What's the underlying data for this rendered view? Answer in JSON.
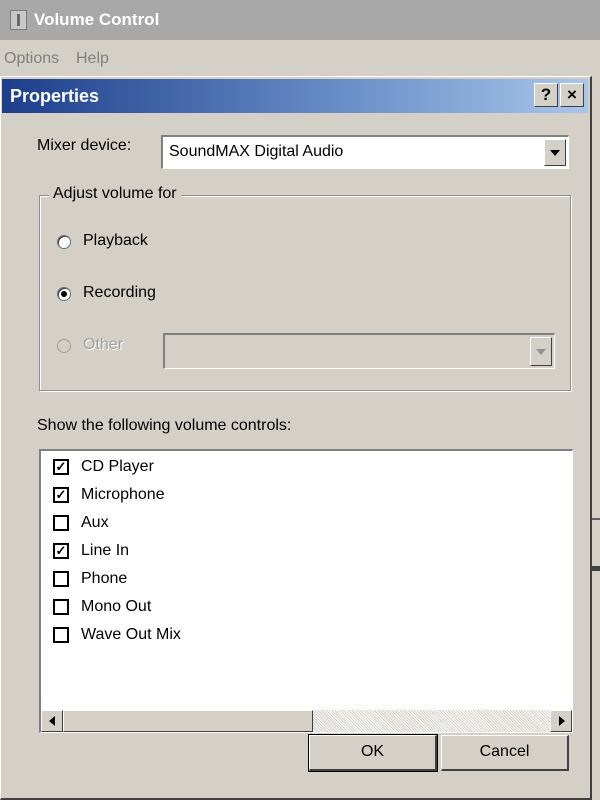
{
  "app": {
    "title": "Volume Control",
    "menu": [
      "Options",
      "Help"
    ]
  },
  "dialog": {
    "title": "Properties",
    "help_button": "?",
    "close_button": "×",
    "mixer_label": "Mixer device:",
    "mixer_value": "SoundMAX Digital Audio",
    "adjust_group": "Adjust volume for",
    "radios": [
      {
        "label": "Playback",
        "checked": false,
        "enabled": true
      },
      {
        "label": "Recording",
        "checked": true,
        "enabled": true
      },
      {
        "label": "Other",
        "checked": false,
        "enabled": false
      }
    ],
    "other_value": "",
    "show_label": "Show the following volume controls:",
    "controls": [
      {
        "label": "CD Player",
        "checked": true
      },
      {
        "label": "Microphone",
        "checked": true
      },
      {
        "label": "Aux",
        "checked": false
      },
      {
        "label": "Line In",
        "checked": true
      },
      {
        "label": "Phone",
        "checked": false
      },
      {
        "label": "Mono Out",
        "checked": false
      },
      {
        "label": "Wave Out Mix",
        "checked": false
      }
    ],
    "ok_label": "OK",
    "cancel_label": "Cancel"
  }
}
